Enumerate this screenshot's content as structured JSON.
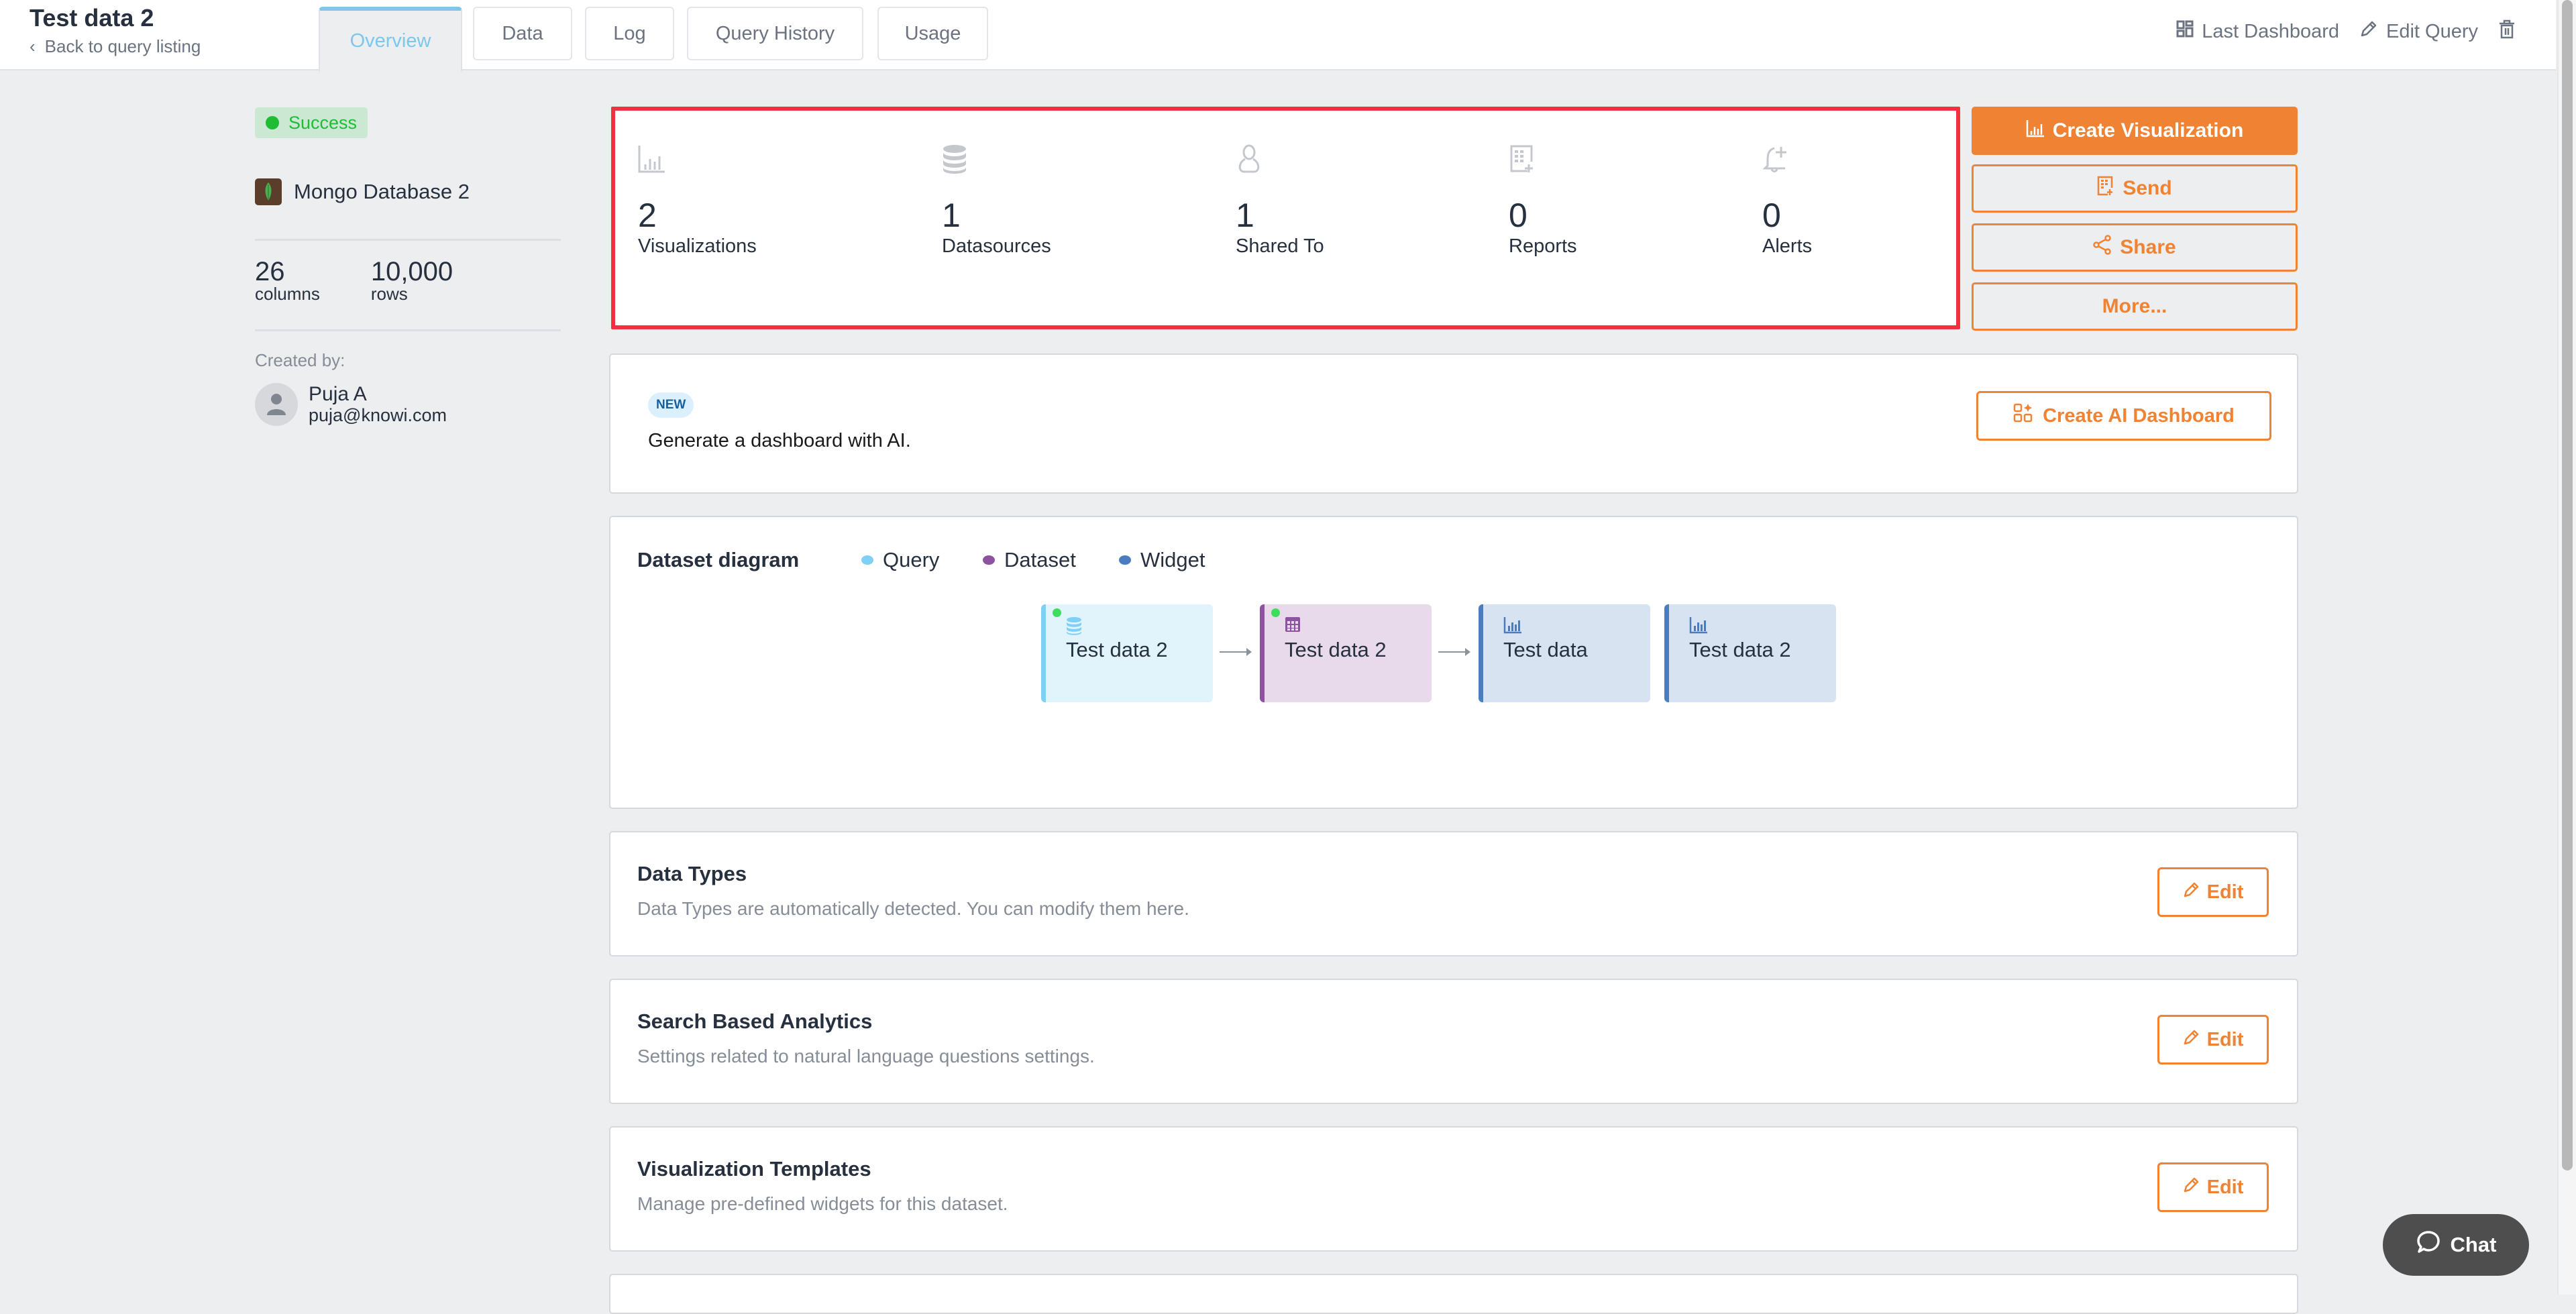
{
  "header": {
    "title": "Test data 2",
    "back_link": "Back to query listing",
    "tabs": [
      {
        "label": "Overview",
        "active": true
      },
      {
        "label": "Data",
        "active": false
      },
      {
        "label": "Log",
        "active": false
      },
      {
        "label": "Query History",
        "active": false
      },
      {
        "label": "Usage",
        "active": false
      }
    ],
    "actions": {
      "last_dashboard": "Last Dashboard",
      "edit_query": "Edit Query",
      "delete_icon": "trash-icon"
    }
  },
  "sidebar": {
    "status": "Success",
    "datasource_name": "Mongo Database 2",
    "columns_value": "26",
    "columns_label": "columns",
    "rows_value": "10,000",
    "rows_label": "rows",
    "created_by_label": "Created by:",
    "creator_name": "Puja A",
    "creator_email": "puja@knowi.com"
  },
  "stats": [
    {
      "icon": "bar-chart-icon",
      "value": "2",
      "label": "Visualizations"
    },
    {
      "icon": "database-icon",
      "value": "1",
      "label": "Datasources"
    },
    {
      "icon": "user-icon",
      "value": "1",
      "label": "Shared To"
    },
    {
      "icon": "report-icon",
      "value": "0",
      "label": "Reports"
    },
    {
      "icon": "bell-icon",
      "value": "0",
      "label": "Alerts"
    }
  ],
  "actions": {
    "create_visualization": "Create Visualization",
    "send": "Send",
    "share": "Share",
    "more": "More..."
  },
  "ai_card": {
    "badge": "NEW",
    "text": "Generate a dashboard with AI.",
    "button": "Create AI Dashboard"
  },
  "diagram": {
    "title": "Dataset diagram",
    "legend": [
      {
        "label": "Query",
        "color": "#7fd0f5"
      },
      {
        "label": "Dataset",
        "color": "#8e53a0"
      },
      {
        "label": "Widget",
        "color": "#4a7dbf"
      }
    ],
    "nodes": [
      {
        "type": "Query",
        "label": "Test data 2"
      },
      {
        "type": "Dataset",
        "label": "Test data 2"
      },
      {
        "type": "Widget",
        "label": "Test data"
      },
      {
        "type": "Widget",
        "label": "Test data 2"
      }
    ]
  },
  "sections": [
    {
      "title": "Data Types",
      "description": "Data Types are automatically detected. You can modify them here.",
      "button": "Edit"
    },
    {
      "title": "Search Based Analytics",
      "description": "Settings related to natural language questions settings.",
      "button": "Edit"
    },
    {
      "title": "Visualization Templates",
      "description": "Manage pre-defined widgets for this dataset.",
      "button": "Edit"
    }
  ],
  "chat": {
    "label": "Chat"
  },
  "colors": {
    "accent": "#ef8333",
    "active_tab": "#7cc7ea",
    "success": "#1fbd34",
    "highlight_border": "#f2303f"
  }
}
